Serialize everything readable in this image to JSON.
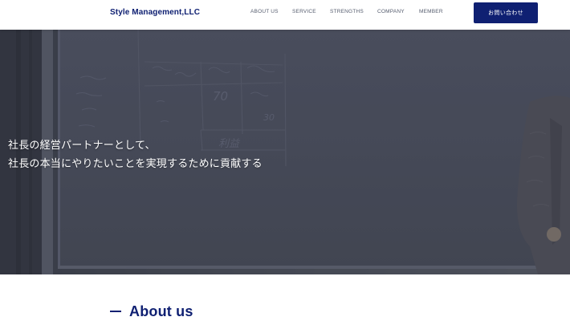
{
  "header": {
    "brand": "Style Management,LLC",
    "nav": [
      "ABOUT US",
      "SERVICE",
      "STRENGTHS",
      "COMPANY",
      "MEMBER"
    ],
    "cta_label": "お問い合わせ"
  },
  "hero": {
    "lines": [
      "社長の経営パートナーとして、",
      "社長の本当にやりたいことを実現するために貢献する"
    ],
    "whiteboard_notes": [
      "70",
      "30",
      "利益"
    ]
  },
  "about": {
    "heading": "About us"
  },
  "colors": {
    "brand_navy": "#0f2072",
    "nav_text": "#555c6e",
    "hero_dark": "#4b4f5c"
  }
}
